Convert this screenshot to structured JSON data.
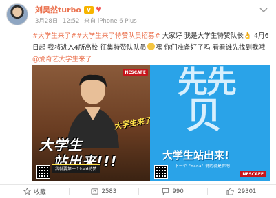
{
  "post": {
    "author": "刘昊然turbo",
    "vip_badge": "V",
    "heart_badge": "♥",
    "date": "3月28日",
    "time": "12:52",
    "source": "来自 iPhone 6 Plus",
    "body": {
      "tag1": "#大学生来了#",
      "tag2": "#大学生来了特赞队员招募#",
      "text1": " 大家好 我是大学生特赞队长",
      "hand_emoji": "👌",
      "text2": " 4月6日起 我将进入4所高校 征集特赞队队员",
      "text3": "嘿 你们准备好了吗 看看谁先找到我哦",
      "mention": "@爱奇艺大学生来了"
    }
  },
  "posters": {
    "left": {
      "brand_tag": "NESCAFE",
      "slogan_line1": "大学生",
      "slogan_line2": "站出来!!!",
      "side_text": "大学生来了",
      "badge": "我就要第一个kaid特赞"
    },
    "right": {
      "big_line1": "先先",
      "big_line2": "贝",
      "slogan": "大学生站出来!",
      "small": "下一个 \"nana\" 说的就是你吧",
      "brand_tag": "NESCAFE"
    }
  },
  "actions": {
    "favorite": "收藏",
    "repost": "2583",
    "comment": "990",
    "like": "29301"
  },
  "colors": {
    "accent": "#eb7350",
    "right_poster_bg": "#2aa3e8"
  }
}
